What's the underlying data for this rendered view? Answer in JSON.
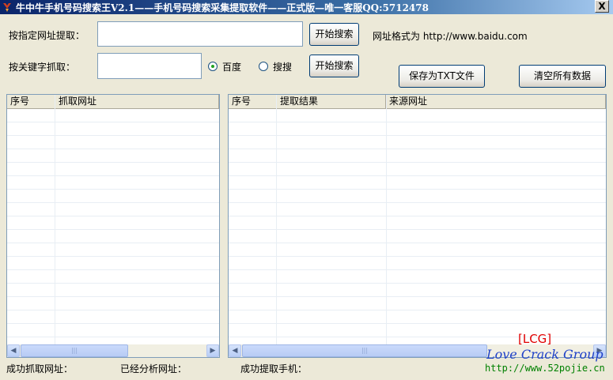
{
  "window": {
    "title": "牛中牛手机号码搜索王V2.1——手机号码搜索采集提取软件——正式版—唯一客服QQ:5712478",
    "close_label": "X"
  },
  "url_row": {
    "label": "按指定网址提取：",
    "input_value": "",
    "search_button": "开始搜索",
    "format_hint": "网址格式为 http://www.baidu.com"
  },
  "keyword_row": {
    "label": "按关键字抓取：",
    "input_value": "",
    "radio_baidu": "百度",
    "radio_sousou": "搜搜",
    "selected_engine": "百度",
    "search_button": "开始搜索"
  },
  "actions": {
    "save_txt": "保存为TXT文件",
    "clear_all": "清空所有数据"
  },
  "left_list": {
    "columns": [
      "序号",
      "抓取网址"
    ],
    "rows": []
  },
  "right_list": {
    "columns": [
      "序号",
      "提取结果",
      "来源网址"
    ],
    "rows": []
  },
  "status": {
    "fetched_urls": "成功抓取网址：",
    "analyzed_urls": "已经分析网址：",
    "extracted_phones": "成功提取手机："
  },
  "watermark": {
    "tag": "[LCG]",
    "group": "Love Crack Group",
    "url": "http://www.52pojie.cn"
  },
  "colors": {
    "titlebar_start": "#0A246A",
    "titlebar_end": "#A6CAF0",
    "window_bg": "#ECE9D8",
    "watermark_red": "#E00000",
    "watermark_blue": "#1E40C8",
    "watermark_green": "#008000"
  },
  "icons": {
    "app": "app-icon",
    "radio_selected": "radio-selected",
    "radio_unselected": "radio-unselected",
    "scroll_left": "chevron-left-icon",
    "scroll_right": "chevron-right-icon"
  }
}
